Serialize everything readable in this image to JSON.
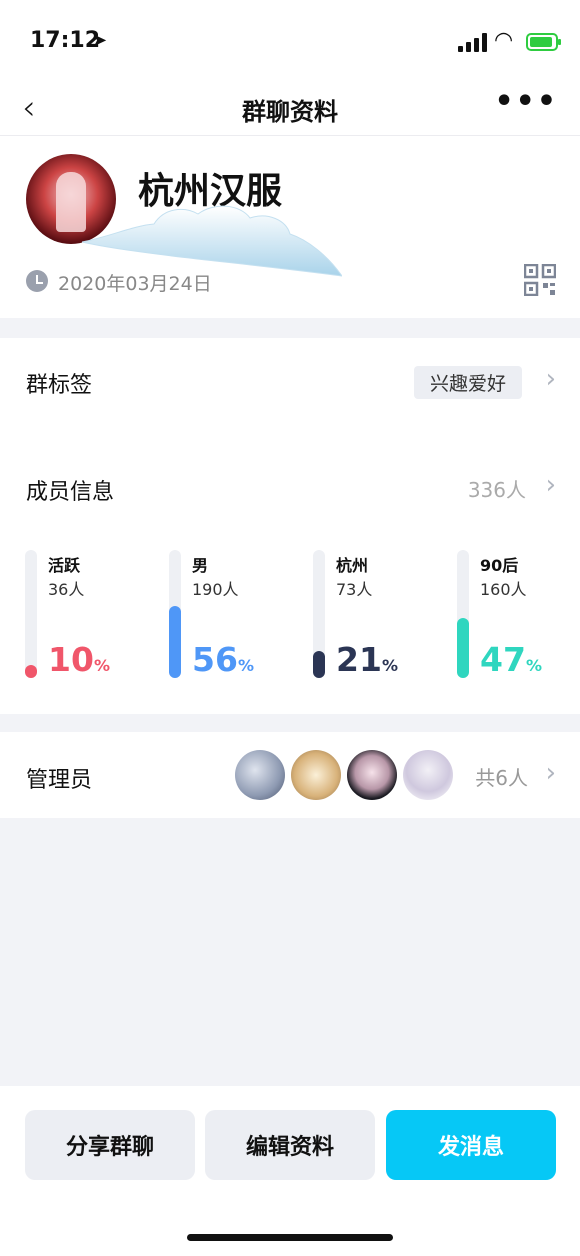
{
  "status_bar": {
    "time": "17:12"
  },
  "nav": {
    "title": "群聊资料"
  },
  "group": {
    "name": "杭州汉服",
    "date": "2020年03月24日"
  },
  "tag_row": {
    "label": "群标签",
    "tag": "兴趣爱好"
  },
  "members": {
    "label": "成员信息",
    "count": "336人",
    "stats": [
      {
        "name": "活跃",
        "count": "36人",
        "percent": "10",
        "unit": "%",
        "fraction": 0.1,
        "color": "#f0566a"
      },
      {
        "name": "男",
        "count": "190人",
        "percent": "56",
        "unit": "%",
        "fraction": 0.56,
        "color": "#4f97f7"
      },
      {
        "name": "杭州",
        "count": "73人",
        "percent": "21",
        "unit": "%",
        "fraction": 0.21,
        "color": "#2b3554"
      },
      {
        "name": "90后",
        "count": "160人",
        "percent": "47",
        "unit": "%",
        "fraction": 0.47,
        "color": "#2fd6bf"
      }
    ]
  },
  "admins": {
    "label": "管理员",
    "total": "共6人"
  },
  "actions": {
    "share": "分享群聊",
    "edit": "编辑资料",
    "send": "发消息"
  }
}
